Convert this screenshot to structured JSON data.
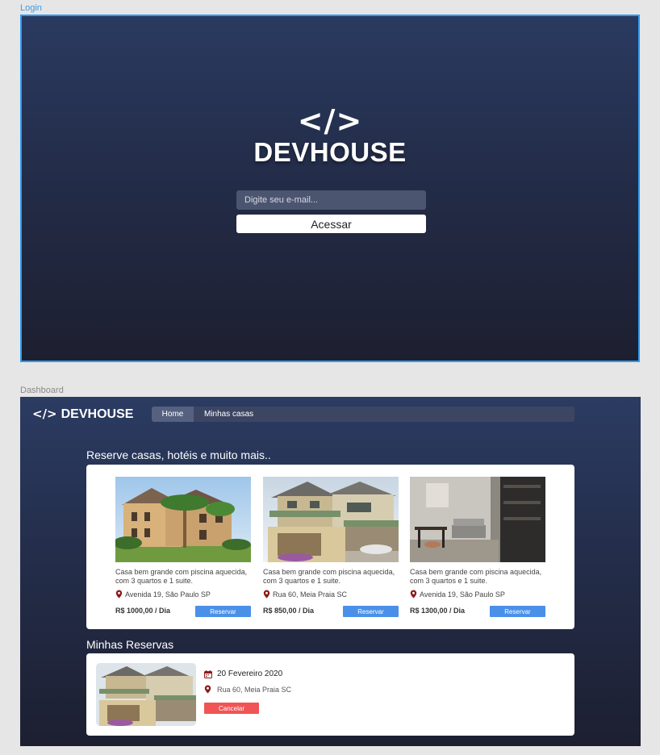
{
  "frames": {
    "login_label": "Login",
    "dashboard_label": "Dashboard"
  },
  "login": {
    "logo_glyph": "</>",
    "logo_text": "DEVHOUSE",
    "email_placeholder": "Digite seu e-mail...",
    "access_label": "Acessar"
  },
  "dashboard": {
    "brand_glyph": "</>",
    "brand_text": "DEVHOUSE",
    "nav": {
      "home": "Home",
      "minhas_casas": "Minhas casas"
    },
    "section_title": "Reserve casas, hotéis e muito mais..",
    "reserve_label": "Reservar",
    "houses": [
      {
        "description": "Casa bem grande com piscina aquecida, com 3 quartos e 1 suite.",
        "address": "Avenida 19, São Paulo SP",
        "price": "R$ 1000,00 / Dia"
      },
      {
        "description": "Casa bem grande com piscina aquecida, com 3 quartos e 1 suite.",
        "address": "Rua 60,  Meia Praia SC",
        "price": "R$ 850,00 / Dia"
      },
      {
        "description": "Casa bem grande com piscina aquecida, com 3 quartos e 1 suite.",
        "address": "Avenida 19, São Paulo SP",
        "price": "R$ 1300,00 / Dia"
      }
    ],
    "reservations_title": "Minhas Reservas",
    "reservation": {
      "date": "20 Fevereiro 2020",
      "address": "Rua 60,  Meia Praia SC",
      "cancel_label": "Cancelar"
    }
  },
  "colors": {
    "accent": "#4a90e8",
    "danger": "#f05454",
    "pin": "#8b1a1a",
    "selection": "#2d9cf0"
  }
}
